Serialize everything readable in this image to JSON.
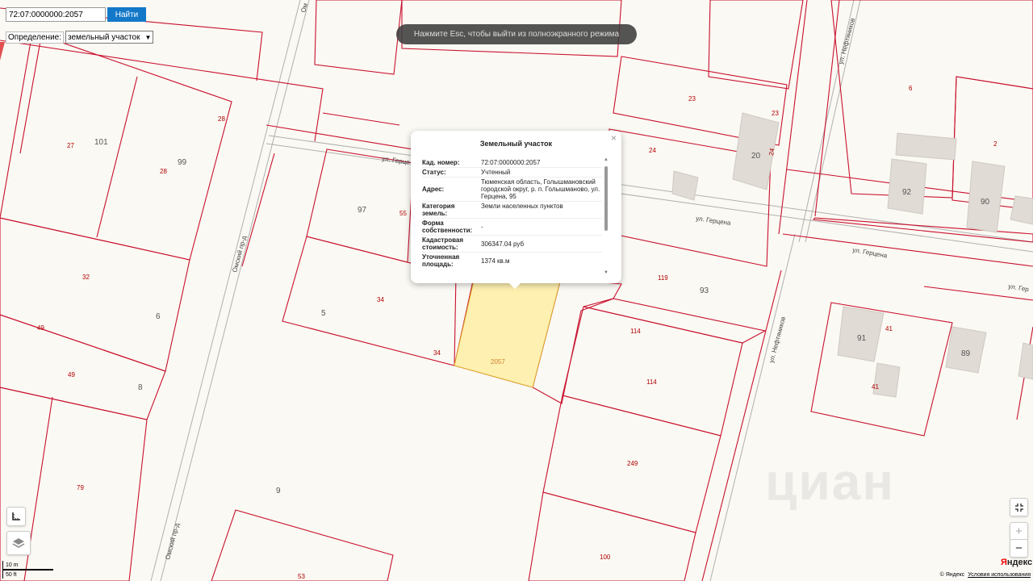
{
  "search": {
    "value": "72:07:0000000:2057",
    "button_label": "Найти"
  },
  "definition": {
    "label": "Определение:",
    "selected": "земельный участок"
  },
  "fullscreen_hint": "Нажмите Esc, чтобы выйти из полноэкранного режима",
  "popup": {
    "title": "Земельный участок",
    "close_glyph": "×",
    "rows": [
      {
        "key": "Кад. номер:",
        "value": "72:07:0000000:2057"
      },
      {
        "key": "Статус:",
        "value": "Учтенный"
      },
      {
        "key": "Адрес:",
        "value": "Тюменская область, Голышмановский городской округ, р. п. Голышманово, ул. Герцена, 95"
      },
      {
        "key": "Категория земель:",
        "value": "Земли населенных пунктов"
      },
      {
        "key": "Форма собственности:",
        "value": "-"
      },
      {
        "key": "Кадастровая стоимость:",
        "value": "306347.04 руб"
      },
      {
        "key": "Уточненная площадь:",
        "value": "1374 кв.м"
      }
    ]
  },
  "map": {
    "streets": {
      "omsky_1": "Омский пр-д",
      "omsky_2": "Омский пр-д",
      "omsky_top": "Ом",
      "gertsena_1": "ул. Герце",
      "gertsena_2": "ул. Герцена",
      "gertsena_3": "ул. Герцена",
      "gertsena_4": "ул. Гер",
      "neftyanikov_1": "ул. Нефтяников",
      "neftyanikov_2": "ул. Нефтяников"
    },
    "parcel_labels": {
      "p27": "27",
      "p28a": "28",
      "p28b": "28",
      "p55": "55",
      "p34a": "34",
      "p34b": "34",
      "p32": "32",
      "p49a": "49",
      "p49b": "49",
      "p79": "79",
      "p53": "53",
      "p2057": "2057",
      "p114a": "114",
      "p114b": "114",
      "p249": "249",
      "p100": "100",
      "p119": "119",
      "p24a": "24",
      "p24b": "24",
      "p23a": "23",
      "p23b": "23",
      "p6": "6",
      "p2": "2",
      "p41a": "41",
      "p41b": "41"
    },
    "house_numbers": {
      "h101": "101",
      "h99": "99",
      "h97": "97",
      "h5": "5",
      "h6": "6",
      "h8": "8",
      "h9": "9",
      "h93": "93",
      "h20": "20",
      "h92": "92",
      "h90": "90",
      "h91": "91",
      "h89": "89"
    },
    "selected_fill": "#fdf0b0",
    "boundary_color": "#c8102e"
  },
  "scale": {
    "top": "10 m",
    "bottom": "50 ft"
  },
  "logo": {
    "first": "Я",
    "rest": "ндекс"
  },
  "copyright": {
    "text": "© Яндекс",
    "terms": "Условия использования"
  },
  "watermark": "циан"
}
